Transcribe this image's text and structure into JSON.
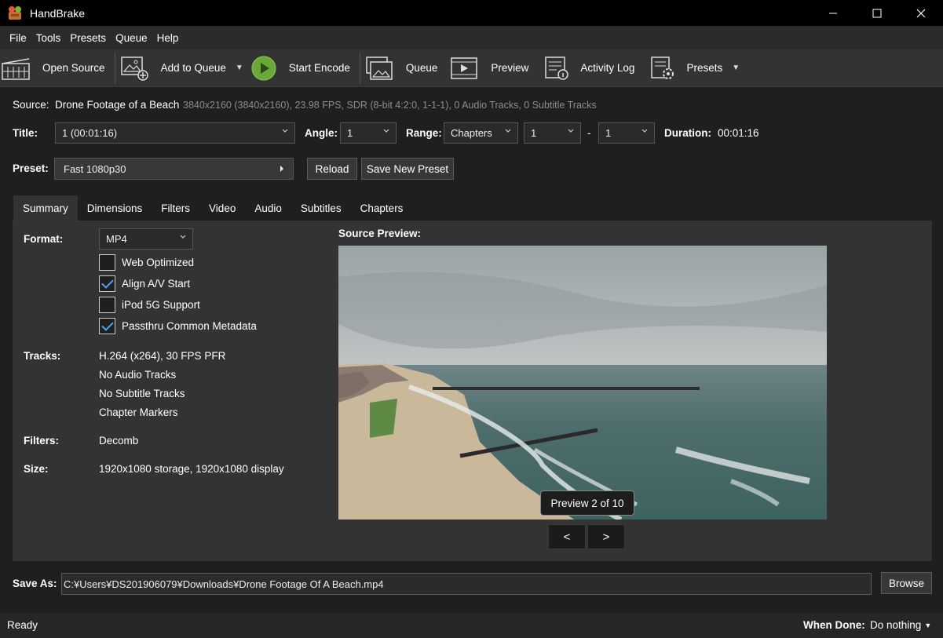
{
  "window": {
    "title": "HandBrake",
    "minimize": "—",
    "maximize": "☐",
    "close": "✕"
  },
  "menu": [
    "File",
    "Tools",
    "Presets",
    "Queue",
    "Help"
  ],
  "toolbar": {
    "open_source": "Open Source",
    "add_to_queue": "Add to Queue",
    "start_encode": "Start Encode",
    "queue": "Queue",
    "preview": "Preview",
    "activity_log": "Activity Log",
    "presets": "Presets"
  },
  "source": {
    "label": "Source:",
    "name": "Drone Footage of a Beach",
    "info": "3840x2160 (3840x2160), 23.98 FPS, SDR (8-bit 4:2:0, 1-1-1), 0 Audio Tracks, 0 Subtitle Tracks"
  },
  "title_row": {
    "title_label": "Title:",
    "title_value": "1  (00:01:16)",
    "angle_label": "Angle:",
    "angle_value": "1",
    "range_label": "Range:",
    "range_value": "Chapters",
    "range_start": "1",
    "range_dash": "-",
    "range_end": "1",
    "duration_label": "Duration:",
    "duration_value": "00:01:16"
  },
  "preset_row": {
    "label": "Preset:",
    "value": "Fast 1080p30",
    "reload": "Reload",
    "save_new": "Save New Preset"
  },
  "tabs": [
    "Summary",
    "Dimensions",
    "Filters",
    "Video",
    "Audio",
    "Subtitles",
    "Chapters"
  ],
  "summary": {
    "format_label": "Format:",
    "format_value": "MP4",
    "checkboxes": [
      {
        "label": "Web Optimized",
        "checked": false
      },
      {
        "label": "Align A/V Start",
        "checked": true
      },
      {
        "label": "iPod 5G Support",
        "checked": false
      },
      {
        "label": "Passthru Common Metadata",
        "checked": true
      }
    ],
    "tracks_label": "Tracks:",
    "tracks": [
      "H.264 (x264), 30 FPS PFR",
      "No Audio Tracks",
      "No Subtitle Tracks",
      "Chapter Markers"
    ],
    "filters_label": "Filters:",
    "filters_value": "Decomb",
    "size_label": "Size:",
    "size_value": "1920x1080 storage, 1920x1080 display"
  },
  "preview": {
    "label": "Source Preview:",
    "badge": "Preview 2 of 10",
    "prev": "<",
    "next": ">"
  },
  "save": {
    "label": "Save As:",
    "path": "C:¥Users¥DS201906079¥Downloads¥Drone Footage Of A Beach.mp4",
    "browse": "Browse"
  },
  "status": {
    "text": "Ready",
    "when_done_label": "When Done:",
    "when_done_value": "Do nothing"
  },
  "colors": {
    "accent": "#4aa3ff",
    "bg": "#1f1f1f",
    "panel": "#333333"
  }
}
